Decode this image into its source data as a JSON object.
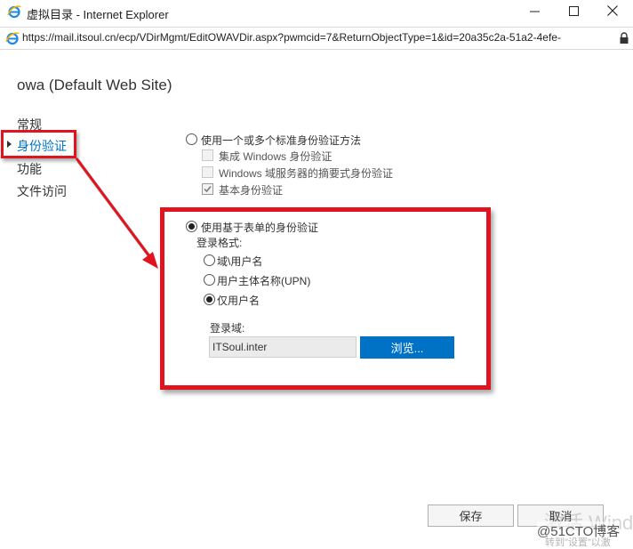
{
  "window": {
    "title": "虚拟目录 - Internet Explorer",
    "minimize_glyph": "—",
    "maximize_glyph": "☐",
    "close_glyph": "✕"
  },
  "address": {
    "url": "https://mail.itsoul.cn/ecp/VDirMgmt/EditOWAVDir.aspx?pwmcid=7&ReturnObjectType=1&id=20a35c2a-51a2-4efe-"
  },
  "page": {
    "title": "owa (Default Web Site)"
  },
  "nav": {
    "general": "常规",
    "authentication": "身份验证",
    "features": "功能",
    "file_access": "文件访问"
  },
  "auth": {
    "standard_option": "使用一个或多个标准身份验证方法",
    "integrated_windows": "集成 Windows 身份验证",
    "digest": "Windows 域服务器的摘要式身份验证",
    "basic": "基本身份验证",
    "forms_option": "使用基于表单的身份验证",
    "logon_format_label": "登录格式:",
    "format_domain_user": "域\\用户名",
    "format_upn": "用户主体名称(UPN)",
    "format_username_only": "仅用户名",
    "logon_domain_label": "登录域:",
    "logon_domain_value": "ITSoul.inter",
    "browse_label": "浏览..."
  },
  "footer": {
    "save": "保存",
    "cancel": "取消"
  },
  "watermark": {
    "windows": "激活 Windo",
    "blog": "@51CTO博客",
    "settings": "转到\"设置\"以激"
  },
  "colors": {
    "accent": "#0072c6",
    "highlight_border": "#e0141e"
  }
}
